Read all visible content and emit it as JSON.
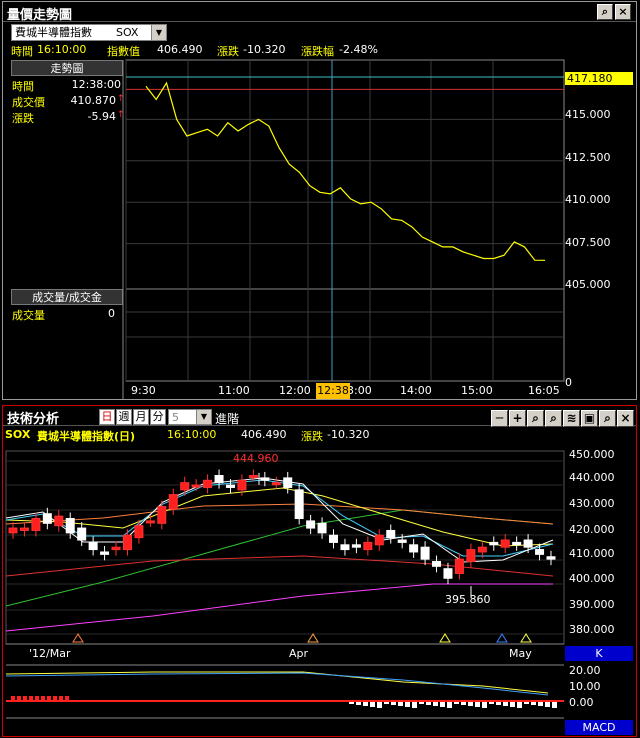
{
  "top_window": {
    "title": "量價走勢圖",
    "symbol_select": "費城半導體指數",
    "symbol_code": "SOX",
    "info_time_label": "時間",
    "info_time": "16:10:00",
    "info_index_label": "指數值",
    "info_index": "406.490",
    "info_change_label": "漲跌",
    "info_change": "-10.320",
    "info_pct_label": "漲跌幅",
    "info_pct": "-2.48%",
    "trend_header": "走勢圖",
    "row_time_label": "時間",
    "row_time": "12:38:00",
    "row_price_label": "成交價",
    "row_price": "410.870",
    "row_change_label": "漲跌",
    "row_change": "-5.94",
    "volume_header": "成交量/成交金",
    "volume_label": "成交量",
    "volume_value": "0",
    "cursor_time": "12:38",
    "current_price_tag": "417.180",
    "yticks": [
      "415.000",
      "412.500",
      "410.000",
      "407.500",
      "405.000"
    ],
    "vol_ytick": "0",
    "xticks": [
      "9:30",
      "11:00",
      "12:00",
      "13:00",
      "14:00",
      "15:00",
      "16:05"
    ]
  },
  "bottom_window": {
    "title": "技術分析",
    "period_day": "日",
    "period_week": "週",
    "period_month": "月",
    "period_minute": "分",
    "interval_value": "5",
    "advanced_label": "進階",
    "symbol_code": "SOX",
    "symbol_name": "費城半導體指數(日)",
    "time": "16:10:00",
    "price": "406.490",
    "change_label": "漲跌",
    "change": "-10.320",
    "high_label": "444.960",
    "low_label": "395.860",
    "yticks": [
      "450.000",
      "440.000",
      "430.000",
      "420.000",
      "410.000",
      "400.000",
      "390.000",
      "380.000"
    ],
    "xticks": [
      "'12/Mar",
      "Apr",
      "May"
    ],
    "k_tag": "K",
    "macd_tag": "MACD",
    "macd_yticks": [
      "20.00",
      "10.00",
      "0.00"
    ]
  },
  "chart_data": [
    {
      "type": "line",
      "series": [
        {
          "x": [
            "9:30",
            "9:40",
            "9:50",
            "10:00",
            "10:10",
            "10:20",
            "10:30",
            "10:40",
            "10:50",
            "11:00",
            "11:10",
            "11:20",
            "11:30",
            "11:40",
            "11:50",
            "12:00",
            "12:10",
            "12:20",
            "12:30",
            "12:38",
            "12:50",
            "13:00",
            "13:10",
            "13:20",
            "13:30",
            "13:40",
            "13:50",
            "14:00",
            "14:10",
            "14:20",
            "14:30",
            "14:40",
            "14:50",
            "15:00",
            "15:10",
            "15:20",
            "15:30",
            "15:40",
            "15:50",
            "16:00"
          ],
          "values": [
            417.0,
            416.2,
            417.2,
            415.0,
            414.0,
            414.2,
            414.4,
            414.0,
            414.8,
            414.3,
            414.7,
            415.0,
            414.6,
            413.3,
            412.3,
            411.8,
            411.0,
            410.6,
            410.5,
            410.87,
            410.2,
            409.9,
            410.0,
            409.6,
            409.0,
            408.9,
            408.5,
            407.9,
            407.6,
            407.3,
            407.3,
            407.0,
            406.8,
            406.6,
            406.6,
            406.8,
            407.6,
            407.3,
            406.5,
            406.49
          ]
        }
      ],
      "ylim": [
        405.0,
        417.5
      ],
      "reference_price": 416.81
    },
    {
      "type": "bar",
      "x": [
        "'12/Mar",
        "Apr",
        "May"
      ],
      "high": 444.96,
      "low": 395.86,
      "ylim": [
        375,
        452
      ]
    }
  ]
}
